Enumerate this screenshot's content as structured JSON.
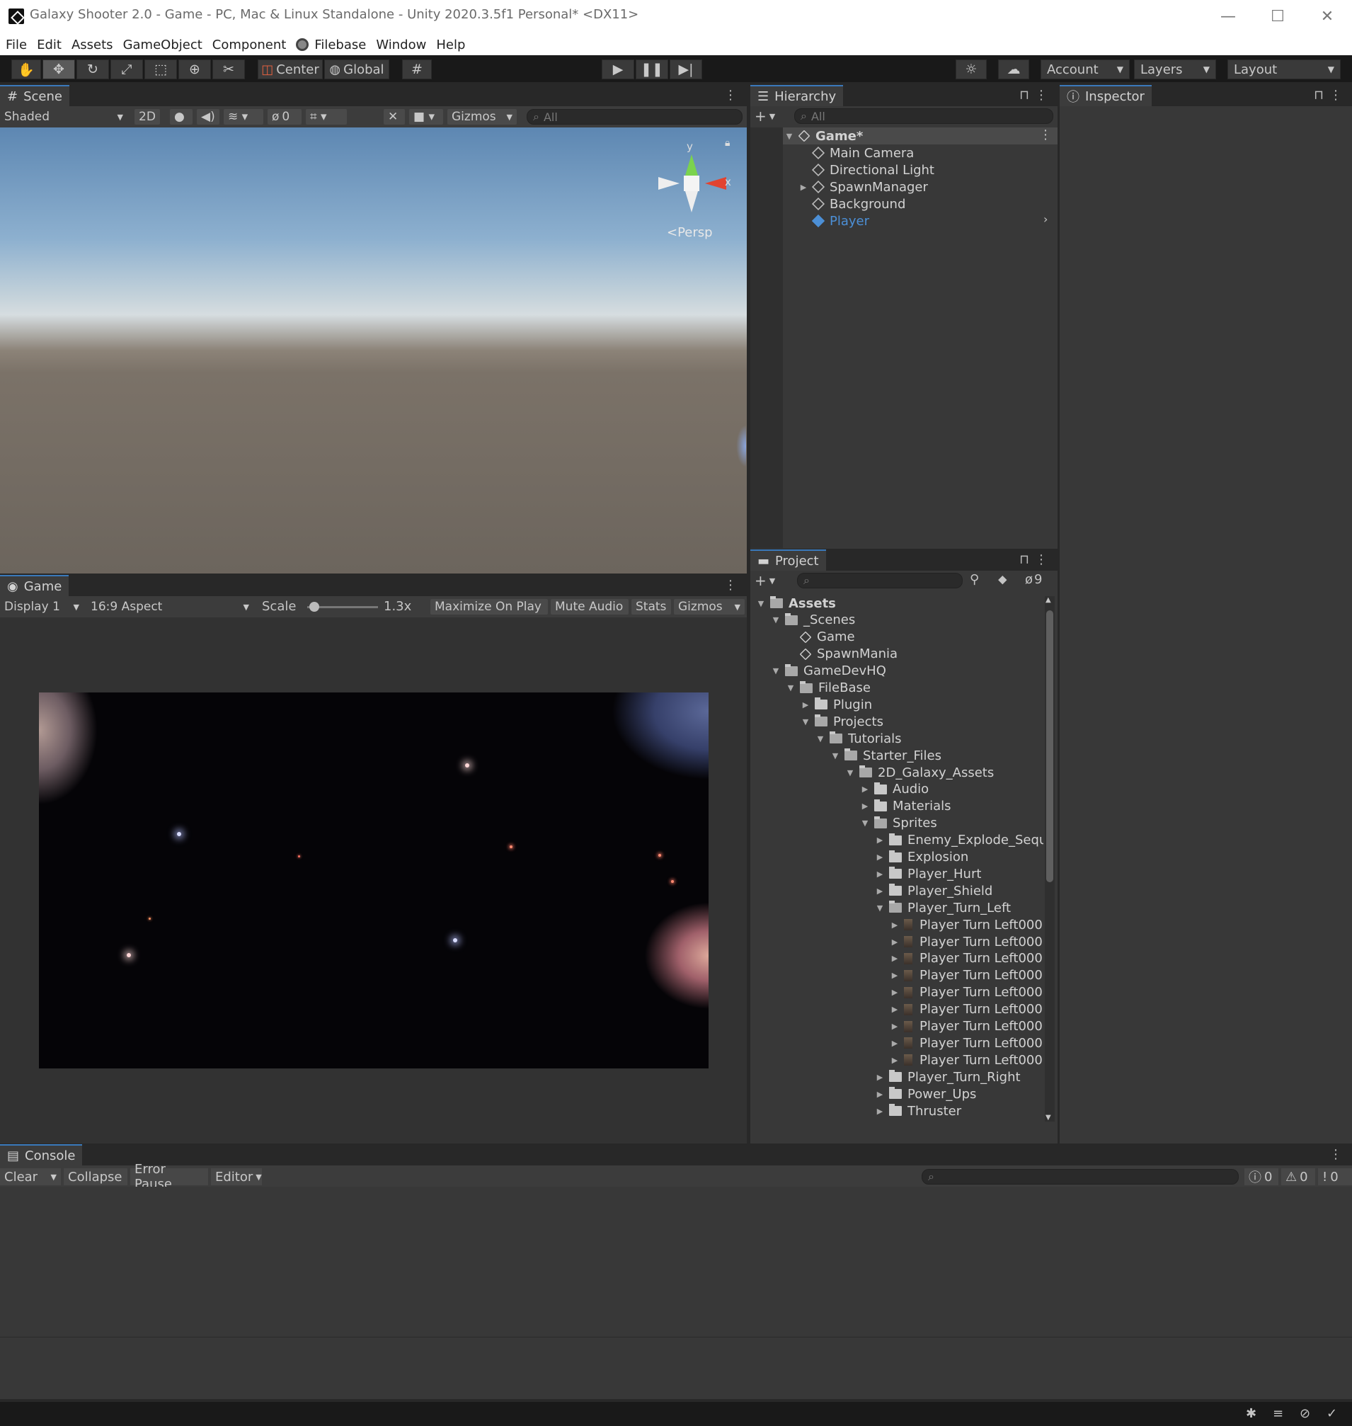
{
  "window": {
    "title": "Galaxy Shooter 2.0 - Game - PC, Mac & Linux Standalone - Unity 2020.3.5f1 Personal* <DX11>",
    "minimize": "—",
    "maximize": "☐",
    "close": "✕"
  },
  "menu": [
    "File",
    "Edit",
    "Assets",
    "GameObject",
    "Component",
    "Filebase",
    "Window",
    "Help"
  ],
  "toolbar": {
    "pivot": "Center",
    "space": "Global",
    "account": "Account",
    "layers": "Layers",
    "layout": "Layout"
  },
  "scene": {
    "tab": "Scene",
    "shading": "Shaded",
    "mode_2d": "2D",
    "hidden_count": "0",
    "gizmos": "Gizmos",
    "search_placeholder": "All",
    "axis_y": "y",
    "axis_x": "x",
    "persp": "<Persp"
  },
  "game": {
    "tab": "Game",
    "display": "Display 1",
    "aspect": "16:9 Aspect",
    "scale_label": "Scale",
    "scale_value": "1.3x",
    "scale_fraction": 0.1,
    "maximize": "Maximize On Play",
    "mute": "Mute Audio",
    "stats": "Stats",
    "gizmos": "Gizmos"
  },
  "hierarchy": {
    "tab": "Hierarchy",
    "search_placeholder": "All",
    "scene_name": "Game*",
    "items": [
      "Main Camera",
      "Directional Light",
      "SpawnManager",
      "Background",
      "Player"
    ]
  },
  "inspector": {
    "tab": "Inspector"
  },
  "project": {
    "tab": "Project",
    "hidden_count": "9",
    "tree": [
      {
        "label": "Assets",
        "depth": 0,
        "type": "folder-open",
        "expanded": true,
        "bold": true
      },
      {
        "label": "_Scenes",
        "depth": 1,
        "type": "folder-open",
        "expanded": true
      },
      {
        "label": "Game",
        "depth": 2,
        "type": "scene"
      },
      {
        "label": "SpawnMania",
        "depth": 2,
        "type": "scene"
      },
      {
        "label": "GameDevHQ",
        "depth": 1,
        "type": "folder-open",
        "expanded": true
      },
      {
        "label": "FileBase",
        "depth": 2,
        "type": "folder-open",
        "expanded": true
      },
      {
        "label": "Plugin",
        "depth": 3,
        "type": "folder",
        "expanded": false
      },
      {
        "label": "Projects",
        "depth": 3,
        "type": "folder-open",
        "expanded": true
      },
      {
        "label": "Tutorials",
        "depth": 4,
        "type": "folder-open",
        "expanded": true
      },
      {
        "label": "Starter_Files",
        "depth": 5,
        "type": "folder-open",
        "expanded": true
      },
      {
        "label": "2D_Galaxy_Assets",
        "depth": 6,
        "type": "folder-open",
        "expanded": true
      },
      {
        "label": "Audio",
        "depth": 7,
        "type": "folder",
        "expanded": false
      },
      {
        "label": "Materials",
        "depth": 7,
        "type": "folder",
        "expanded": false
      },
      {
        "label": "Sprites",
        "depth": 7,
        "type": "folder-open",
        "expanded": true
      },
      {
        "label": "Enemy_Explode_Seque",
        "depth": 8,
        "type": "folder",
        "expanded": false
      },
      {
        "label": "Explosion",
        "depth": 8,
        "type": "folder",
        "expanded": false
      },
      {
        "label": "Player_Hurt",
        "depth": 8,
        "type": "folder",
        "expanded": false
      },
      {
        "label": "Player_Shield",
        "depth": 8,
        "type": "folder",
        "expanded": false
      },
      {
        "label": "Player_Turn_Left",
        "depth": 8,
        "type": "folder-open",
        "expanded": true
      },
      {
        "label": "Player Turn Left000",
        "depth": 9,
        "type": "sprite",
        "expanded": false
      },
      {
        "label": "Player Turn Left000",
        "depth": 9,
        "type": "sprite",
        "expanded": false
      },
      {
        "label": "Player Turn Left000",
        "depth": 9,
        "type": "sprite",
        "expanded": false
      },
      {
        "label": "Player Turn Left000",
        "depth": 9,
        "type": "sprite",
        "expanded": false
      },
      {
        "label": "Player Turn Left000",
        "depth": 9,
        "type": "sprite",
        "expanded": false
      },
      {
        "label": "Player Turn Left000",
        "depth": 9,
        "type": "sprite",
        "expanded": false
      },
      {
        "label": "Player Turn Left000",
        "depth": 9,
        "type": "sprite",
        "expanded": false
      },
      {
        "label": "Player Turn Left000",
        "depth": 9,
        "type": "sprite",
        "expanded": false
      },
      {
        "label": "Player Turn Left000",
        "depth": 9,
        "type": "sprite",
        "expanded": false
      },
      {
        "label": "Player_Turn_Right",
        "depth": 8,
        "type": "folder",
        "expanded": false
      },
      {
        "label": "Power_Ups",
        "depth": 8,
        "type": "folder",
        "expanded": false
      },
      {
        "label": "Thruster",
        "depth": 8,
        "type": "folder",
        "expanded": false
      }
    ]
  },
  "console": {
    "tab": "Console",
    "clear": "Clear",
    "collapse": "Collapse",
    "error_pause": "Error Pause",
    "editor": "Editor",
    "info_count": "0",
    "warn_count": "0",
    "error_count": "0"
  },
  "colors": {
    "accent": "#3a79bb",
    "selected_text": "#4c8fd6"
  }
}
